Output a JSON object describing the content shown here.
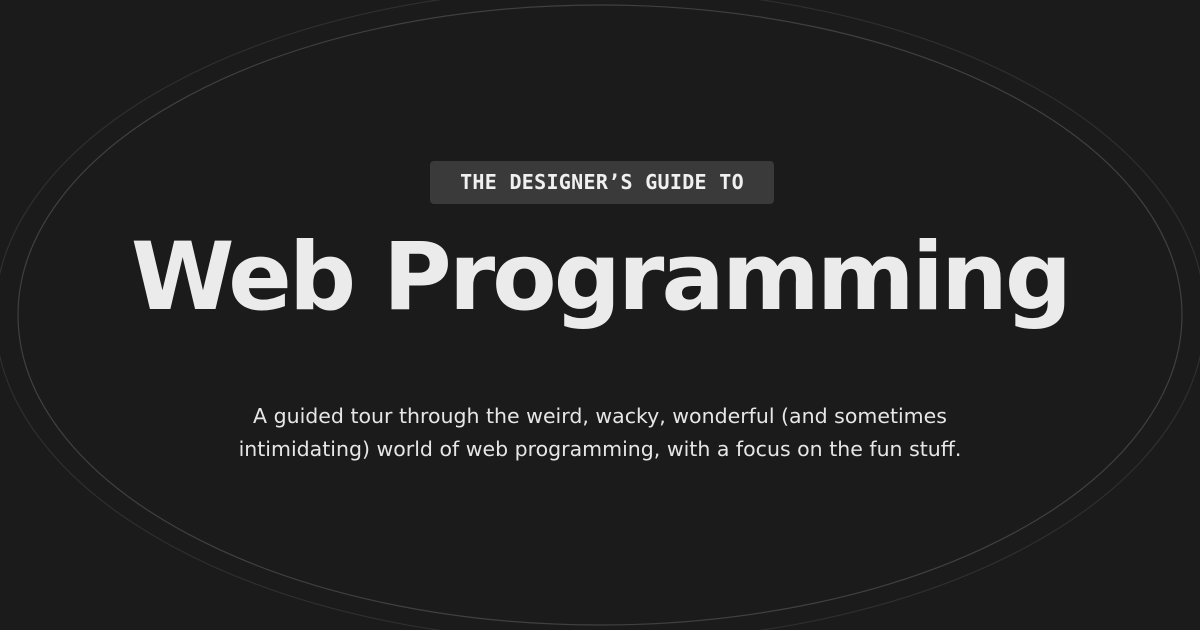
{
  "eyebrow": "THE DESIGNER’S GUIDE TO",
  "title": "Web Programming",
  "subtitle": "A guided tour through the weird, wacky, wonderful (and sometimes intimidating) world of web programming, with a focus on the fun stuff.",
  "colors": {
    "background": "#1b1b1b",
    "text": "#ebebeb",
    "badge_background": "#3a3a3a",
    "ellipse_stroke": "#5a5a5a"
  }
}
